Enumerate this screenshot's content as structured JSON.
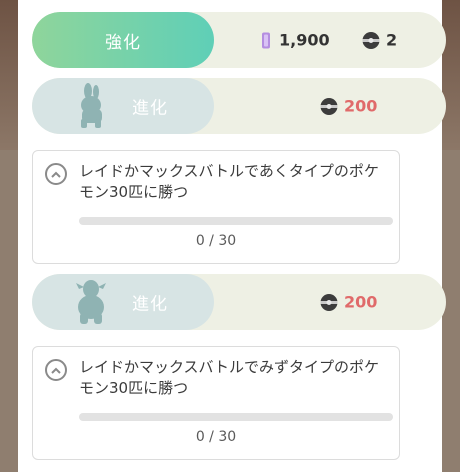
{
  "power_up": {
    "label": "強化",
    "stardust_cost": "1,900",
    "candy_cost": "2"
  },
  "evolutions": [
    {
      "label": "進化",
      "candy_cost": "200",
      "quest": {
        "text": "レイドかマックスバトルであくタイプのポケモン30匹に勝つ",
        "progress_text": "0 / 30",
        "progress_fraction": 0
      }
    },
    {
      "label": "進化",
      "candy_cost": "200",
      "quest": {
        "text": "レイドかマックスバトルでみずタイプのポケモン30匹に勝つ",
        "progress_text": "0 / 30",
        "progress_fraction": 0
      }
    }
  ],
  "colors": {
    "power_gradient_start": "#8fd59b",
    "power_gradient_end": "#5fcfb7",
    "cost_red": "#e06a6a",
    "locked_pill": "#d7e4e4"
  },
  "icons": {
    "stardust": "stardust-icon",
    "candy": "candy-icon",
    "chevron": "chevron-up-icon"
  }
}
